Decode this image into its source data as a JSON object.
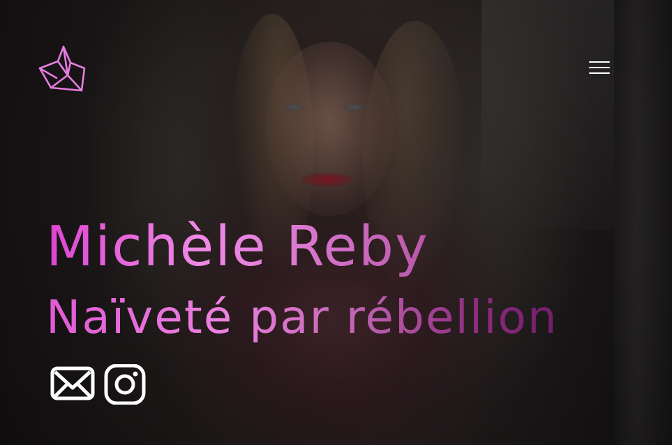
{
  "header": {
    "logo_icon": "crown-icon",
    "menu_icon": "hamburger-menu-icon"
  },
  "hero": {
    "name": "Michèle Reby",
    "tagline": "Naïveté par rébellion"
  },
  "social": [
    {
      "icon": "mail-icon"
    },
    {
      "icon": "instagram-icon"
    }
  ],
  "colors": {
    "accent_pink": "#e57ee0",
    "accent_magenta": "#dc45d0",
    "accent_dark": "#701e68",
    "icon_white": "#ffffff"
  }
}
